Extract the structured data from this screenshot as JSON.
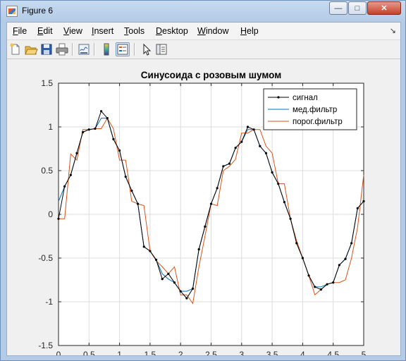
{
  "window": {
    "title": "Figure 6"
  },
  "controls": {
    "minimize": "—",
    "maximize": "□",
    "close": "✕"
  },
  "menu": {
    "items": [
      {
        "mnemonic": "F",
        "rest": "ile"
      },
      {
        "mnemonic": "E",
        "rest": "dit"
      },
      {
        "mnemonic": "V",
        "rest": "iew"
      },
      {
        "mnemonic": "I",
        "rest": "nsert"
      },
      {
        "mnemonic": "T",
        "rest": "ools"
      },
      {
        "mnemonic": "D",
        "rest": "esktop"
      },
      {
        "mnemonic": "W",
        "rest": "indow"
      },
      {
        "mnemonic": "H",
        "rest": "elp"
      }
    ],
    "dock_arrow": "↘"
  },
  "toolbar": {
    "icons": [
      "new-figure-icon",
      "open-file-icon",
      "save-icon",
      "print-icon",
      "link-plot-icon",
      "insert-colorbar-icon",
      "insert-legend-icon",
      "select-arrow-icon",
      "property-editor-icon"
    ]
  },
  "chart_data": {
    "type": "line",
    "title": "Синусоида с розовым шумом",
    "xlabel": "",
    "ylabel": "",
    "xlim": [
      0,
      5
    ],
    "ylim": [
      -1.5,
      1.5
    ],
    "xticks": [
      0,
      0.5,
      1,
      1.5,
      2,
      2.5,
      3,
      3.5,
      4,
      4.5,
      5
    ],
    "yticks": [
      -1.5,
      -1,
      -0.5,
      0,
      0.5,
      1,
      1.5
    ],
    "grid": true,
    "legend_position": "top-right",
    "series": [
      {
        "name": "сигнал",
        "color": "#000000",
        "marker": "dot",
        "x": [
          0,
          0.1,
          0.2,
          0.3,
          0.4,
          0.5,
          0.6,
          0.7,
          0.8,
          0.9,
          1.0,
          1.1,
          1.2,
          1.3,
          1.4,
          1.5,
          1.6,
          1.7,
          1.8,
          1.9,
          2.0,
          2.1,
          2.2,
          2.3,
          2.4,
          2.5,
          2.6,
          2.7,
          2.8,
          2.9,
          3.0,
          3.1,
          3.2,
          3.3,
          3.4,
          3.5,
          3.6,
          3.7,
          3.8,
          3.9,
          4.0,
          4.1,
          4.2,
          4.3,
          4.4,
          4.5,
          4.6,
          4.7,
          4.8,
          4.9,
          5.0
        ],
        "y": [
          -0.05,
          0.32,
          0.45,
          0.7,
          0.94,
          0.97,
          0.98,
          1.18,
          1.1,
          0.86,
          0.73,
          0.43,
          0.27,
          0.12,
          -0.37,
          -0.42,
          -0.52,
          -0.74,
          -0.68,
          -0.78,
          -0.88,
          -0.96,
          -0.85,
          -0.4,
          -0.14,
          0.12,
          0.3,
          0.55,
          0.58,
          0.76,
          0.83,
          1.0,
          0.97,
          0.78,
          0.7,
          0.48,
          0.35,
          0.14,
          -0.05,
          -0.33,
          -0.5,
          -0.7,
          -0.83,
          -0.86,
          -0.8,
          -0.78,
          -0.58,
          -0.51,
          -0.33,
          0.07,
          0.15
        ]
      },
      {
        "name": "мед.фильтр",
        "color": "#0072bd",
        "x": [
          0,
          0.1,
          0.2,
          0.3,
          0.4,
          0.5,
          0.6,
          0.7,
          0.8,
          0.9,
          1.0,
          1.1,
          1.2,
          1.3,
          1.4,
          1.5,
          1.6,
          1.7,
          1.8,
          1.9,
          2.0,
          2.1,
          2.2,
          2.3,
          2.4,
          2.5,
          2.6,
          2.7,
          2.8,
          2.9,
          3.0,
          3.1,
          3.2,
          3.3,
          3.4,
          3.5,
          3.6,
          3.7,
          3.8,
          3.9,
          4.0,
          4.1,
          4.2,
          4.3,
          4.4,
          4.5,
          4.6,
          4.7,
          4.8,
          4.9,
          5.0
        ],
        "y": [
          0.15,
          0.32,
          0.45,
          0.7,
          0.94,
          0.97,
          0.98,
          1.1,
          1.1,
          0.86,
          0.73,
          0.43,
          0.27,
          0.12,
          -0.37,
          -0.42,
          -0.52,
          -0.68,
          -0.74,
          -0.78,
          -0.88,
          -0.88,
          -0.85,
          -0.4,
          -0.14,
          0.12,
          0.3,
          0.55,
          0.58,
          0.76,
          0.83,
          0.97,
          0.97,
          0.78,
          0.7,
          0.48,
          0.35,
          0.14,
          -0.05,
          -0.33,
          -0.5,
          -0.7,
          -0.83,
          -0.83,
          -0.8,
          -0.78,
          -0.58,
          -0.51,
          -0.33,
          0.07,
          0.15
        ]
      },
      {
        "name": "порог.фильтр",
        "color": "#d95319",
        "x": [
          0,
          0.1,
          0.2,
          0.3,
          0.4,
          0.5,
          0.6,
          0.7,
          0.8,
          0.9,
          1.0,
          1.1,
          1.2,
          1.3,
          1.4,
          1.5,
          1.6,
          1.7,
          1.8,
          1.9,
          2.0,
          2.1,
          2.2,
          2.3,
          2.4,
          2.5,
          2.6,
          2.7,
          2.8,
          2.9,
          3.0,
          3.1,
          3.2,
          3.3,
          3.4,
          3.5,
          3.6,
          3.7,
          3.8,
          3.9,
          4.0,
          4.1,
          4.2,
          4.3,
          4.4,
          4.5,
          4.6,
          4.7,
          4.8,
          4.9,
          5.0
        ],
        "y": [
          -0.05,
          -0.05,
          0.69,
          0.62,
          0.97,
          0.97,
          0.98,
          0.98,
          1.1,
          0.98,
          0.62,
          0.62,
          0.15,
          0.12,
          0.1,
          -0.42,
          -0.53,
          -0.6,
          -0.68,
          -0.6,
          -0.92,
          -0.92,
          -1.02,
          -0.6,
          -0.25,
          0.12,
          0.1,
          0.5,
          0.55,
          0.63,
          0.93,
          0.93,
          0.97,
          0.97,
          0.78,
          0.7,
          0.35,
          0.35,
          -0.05,
          -0.3,
          -0.5,
          -0.7,
          -0.92,
          -0.86,
          -0.8,
          -0.78,
          -0.78,
          -0.75,
          -0.5,
          -0.15,
          0.45
        ]
      }
    ]
  }
}
